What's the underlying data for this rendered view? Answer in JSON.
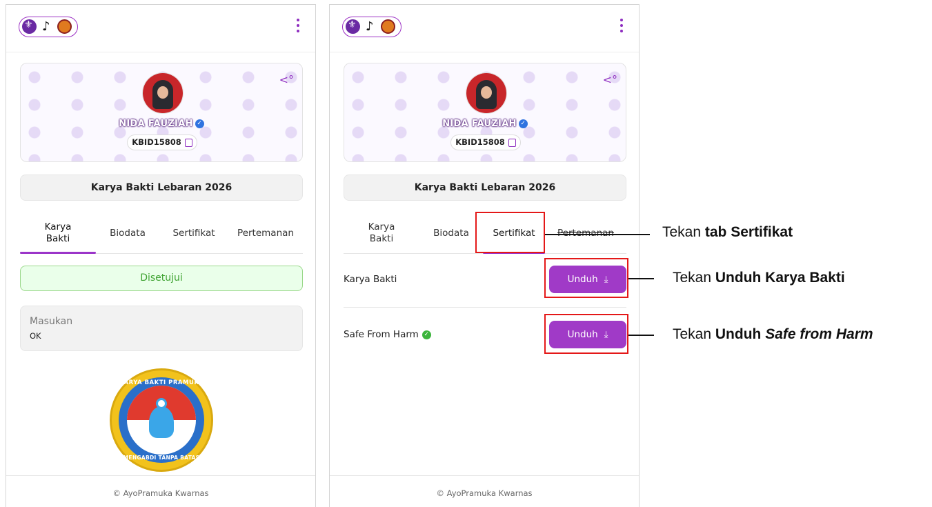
{
  "left": {
    "event_title": "Karya Bakti Lebaran 2026",
    "profile": {
      "name": "NIDA FAUZIAH",
      "id": "KBID15808"
    },
    "tabs": [
      {
        "label": "Karya Bakti",
        "active": true
      },
      {
        "label": "Biodata",
        "active": false
      },
      {
        "label": "Sertifikat",
        "active": false
      },
      {
        "label": "Pertemanan",
        "active": false
      }
    ],
    "status": "Disetujui",
    "note": {
      "label": "Masukan",
      "value": "OK"
    },
    "badge": {
      "top_text": "KARYA BAKTI PRAMUKA",
      "bottom_text": "MENGABDI TANPA BATAS"
    },
    "footer": "© AyoPramuka Kwarnas"
  },
  "right": {
    "event_title": "Karya Bakti Lebaran 2026",
    "profile": {
      "name": "NIDA FAUZIAH",
      "id": "KBID15808"
    },
    "tabs": [
      {
        "label": "Karya Bakti",
        "active": false
      },
      {
        "label": "Biodata",
        "active": false
      },
      {
        "label": "Sertifikat",
        "active": true
      },
      {
        "label": "Pertemanan",
        "active": false
      }
    ],
    "certificates": [
      {
        "label": "Karya Bakti",
        "button": "Unduh",
        "verified": false
      },
      {
        "label": "Safe From Harm",
        "button": "Unduh",
        "verified": true
      }
    ],
    "footer": "© AyoPramuka Kwarnas"
  },
  "annotations": {
    "a1_prefix": "Tekan ",
    "a1_bold": "tab Sertifikat",
    "a1_italic": "",
    "a2_prefix": "Tekan ",
    "a2_bold": "Unduh Karya Bakti",
    "a2_italic": "",
    "a3_prefix": "Tekan ",
    "a3_bold": "Unduh ",
    "a3_italic": "Safe from Harm"
  },
  "colors": {
    "accent": "#a03ac7",
    "success": "#3fa332",
    "highlight": "#e41818"
  },
  "icons": {
    "kebab": "kebab-menu-icon",
    "share": "share-icon",
    "verified": "verified-badge-icon",
    "copy": "copy-icon",
    "download": "download-icon",
    "check": "check-circle-icon"
  }
}
